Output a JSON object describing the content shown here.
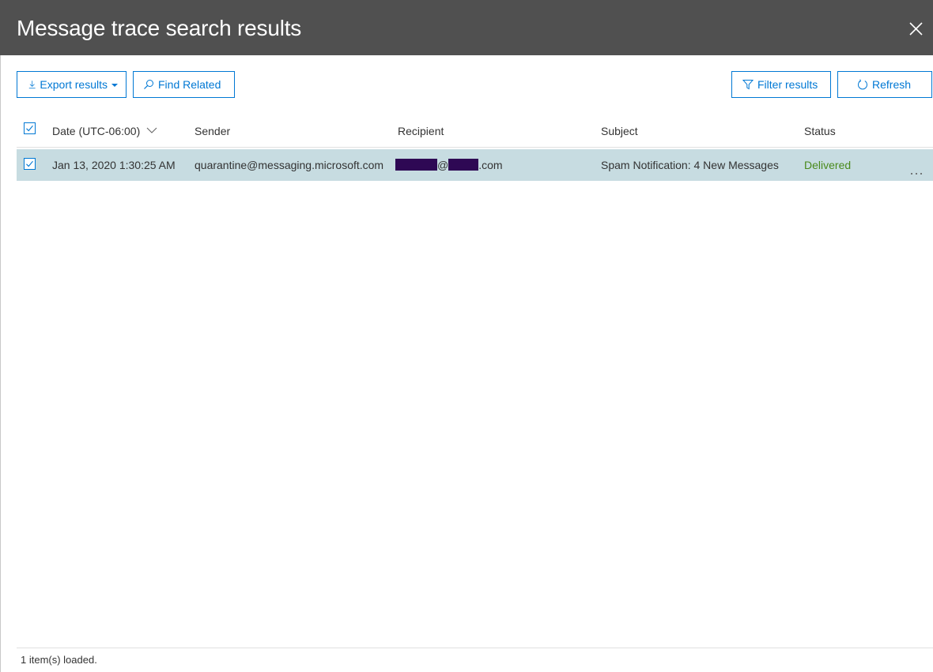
{
  "header": {
    "title": "Message trace search results",
    "close_icon": "close-icon"
  },
  "toolbar": {
    "export_label": "Export results",
    "find_related_label": "Find Related",
    "filter_label": "Filter results",
    "refresh_label": "Refresh"
  },
  "table": {
    "columns": [
      "Date (UTC-06:00)",
      "Sender",
      "Recipient",
      "Subject",
      "Status"
    ],
    "sort_indicator": "chevron-down-icon",
    "rows": [
      {
        "selected": true,
        "date": "Jan 13, 2020 1:30:25 AM",
        "sender": "quarantine@messaging.microsoft.com",
        "recipient_at": "@",
        "recipient_suffix": ".com",
        "subject": "Spam Notification: 4 New Messages",
        "status": "Delivered"
      }
    ]
  },
  "footer": {
    "status_text": "1 item(s) loaded."
  },
  "colors": {
    "header_bg": "#505050",
    "accent": "#0078d4",
    "selected_row": "#c7dce1",
    "status_delivered": "#4a8a1c"
  }
}
